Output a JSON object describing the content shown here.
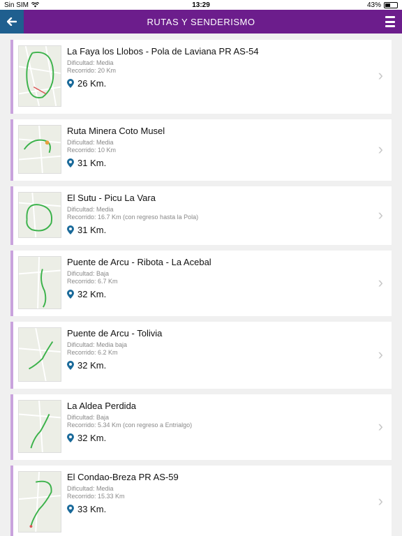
{
  "status": {
    "carrier": "Sin SIM",
    "time": "13:29",
    "battery": "43%",
    "battery_level": 0.43
  },
  "nav": {
    "title": "RUTAS Y SENDERISMO",
    "back_icon": "arrow-left-icon",
    "menu_icon": "hamburger-menu-icon"
  },
  "routes": [
    {
      "name": "La Faya los Llobos - Pola de Laviana PR AS-54",
      "difficulty": "Dificultad: Media",
      "distance": "Recorrido: 20 Km",
      "km": "26 Km."
    },
    {
      "name": "Ruta Minera Coto Musel",
      "difficulty": "Dificultad: Media",
      "distance": "Recorrido: 10 Km",
      "km": "31 Km."
    },
    {
      "name": "El Sutu - Picu La Vara",
      "difficulty": "Dificultad: Media",
      "distance": "Recorrido: 16.7 Km (con regreso hasta la Pola)",
      "km": "31 Km."
    },
    {
      "name": "Puente de Arcu - Ribota - La Acebal",
      "difficulty": "Dificultad: Baja",
      "distance": "Recorrido: 6.7 Km",
      "km": "32 Km."
    },
    {
      "name": "Puente de Arcu - Tolivia",
      "difficulty": "Dificultad: Media baja",
      "distance": "Recorrido: 6.2 Km",
      "km": "32 Km."
    },
    {
      "name": "La Aldea Perdida",
      "difficulty": "Dificultad: Baja",
      "distance": "Recorrido: 5.34 Km (con regreso a Entrialgo)",
      "km": "32 Km."
    },
    {
      "name": "El Condao-Breza PR AS-59",
      "difficulty": "Dificultad: Media",
      "distance": "Recorrido: 15.33 Km",
      "km": "33 Km."
    }
  ],
  "colors": {
    "navbar": "#6c1d8c",
    "back_button": "#1f5f8f",
    "card_accent": "#c9a3dd",
    "pin": "#1a6a9a",
    "route_line": "#3bb24a"
  }
}
